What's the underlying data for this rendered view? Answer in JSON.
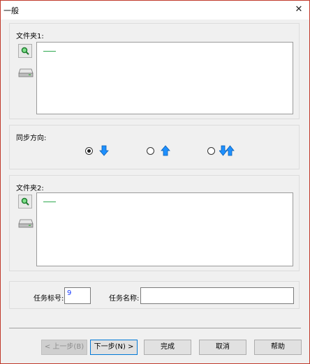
{
  "window": {
    "title": "一般",
    "close_glyph": "✕"
  },
  "folder1": {
    "label": "文件夹1:"
  },
  "sync": {
    "label": "同步方向:",
    "options": [
      {
        "icon": "arrow-down-icon",
        "selected": true
      },
      {
        "icon": "arrow-up-icon",
        "selected": false
      },
      {
        "icon": "arrow-both-icon",
        "selected": false
      }
    ]
  },
  "folder2": {
    "label": "文件夹2:"
  },
  "task": {
    "id_label": "任务标号:",
    "id_value": "9",
    "name_label": "任务名称:",
    "name_value": ""
  },
  "buttons": {
    "back": "< 上一步(B)",
    "next": "下一步(N) >",
    "finish": "完成",
    "cancel": "取消",
    "help": "帮助"
  },
  "colors": {
    "accent": "#0078d7",
    "arrow": "#1e90ff",
    "green": "#2fa84f"
  }
}
